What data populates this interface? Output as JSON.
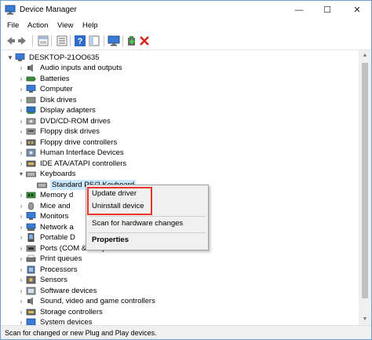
{
  "window": {
    "title": "Device Manager",
    "icon": "device-manager-icon"
  },
  "window_controls": {
    "minimize": "—",
    "maximize": "☐",
    "close": "✕"
  },
  "menu": [
    "File",
    "Action",
    "View",
    "Help"
  ],
  "toolbar": {
    "icons": [
      "back-arrow-icon",
      "forward-arrow-icon",
      "properties-grid-icon",
      "list-icon",
      "help-icon",
      "panel-icon",
      "monitor-scan-icon",
      "add-driver-icon",
      "delete-x-icon"
    ]
  },
  "tree": {
    "root": "DESKTOP-21OO635",
    "categories": [
      "Audio inputs and outputs",
      "Batteries",
      "Computer",
      "Disk drives",
      "Display adapters",
      "DVD/CD-ROM drives",
      "Floppy disk drives",
      "Floppy drive controllers",
      "Human Interface Devices",
      "IDE ATA/ATAPI controllers",
      "Keyboards",
      "Standard PS/2 Keyboard",
      "Memory d",
      "Mice and",
      "Monitors",
      "Network a",
      "Portable D",
      "Ports (COM & LPT)",
      "Print queues",
      "Processors",
      "Sensors",
      "Software devices",
      "Sound, video and game controllers",
      "Storage controllers",
      "System devices"
    ]
  },
  "context_menu": {
    "update_driver": "Update driver",
    "uninstall_device": "Uninstall device",
    "scan": "Scan for hardware changes",
    "properties": "Properties"
  },
  "status": "Scan for changed or new Plug and Play devices.",
  "colors": {
    "highlight_border": "#e8342c",
    "selection": "#cce8ff",
    "window_border": "#6d9ecf"
  }
}
